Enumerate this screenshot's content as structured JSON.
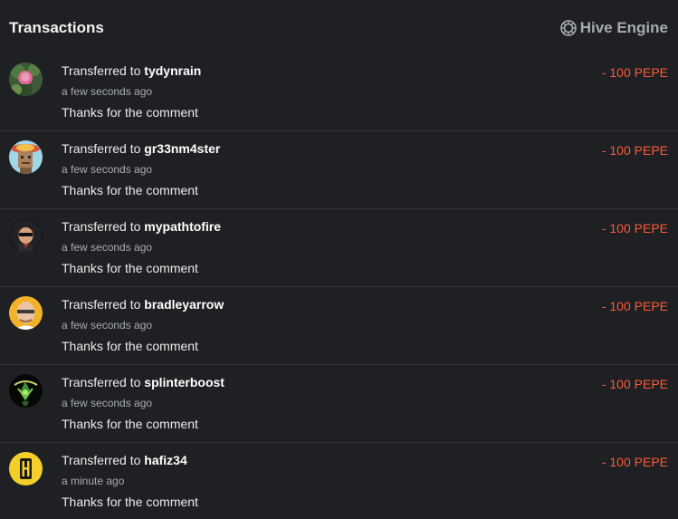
{
  "header": {
    "title": "Transactions",
    "engine_label": "Hive Engine",
    "engine_icon": "hive-engine-icon"
  },
  "colors": {
    "background": "#1e2023",
    "amount": "#ff5a36",
    "divider": "#33363a"
  },
  "transactions": [
    {
      "prefix": "Transferred to",
      "user": "tydynrain",
      "time": "a few seconds ago",
      "memo": "Thanks for the comment",
      "amount": "- 100 PEPE",
      "avatar": "avatar-tydynrain"
    },
    {
      "prefix": "Transferred to",
      "user": "gr33nm4ster",
      "time": "a few seconds ago",
      "memo": "Thanks for the comment",
      "amount": "- 100 PEPE",
      "avatar": "avatar-gr33nm4ster"
    },
    {
      "prefix": "Transferred to",
      "user": "mypathtofire",
      "time": "a few seconds ago",
      "memo": "Thanks for the comment",
      "amount": "- 100 PEPE",
      "avatar": "avatar-mypathtofire"
    },
    {
      "prefix": "Transferred to",
      "user": "bradleyarrow",
      "time": "a few seconds ago",
      "memo": "Thanks for the comment",
      "amount": "- 100 PEPE",
      "avatar": "avatar-bradleyarrow"
    },
    {
      "prefix": "Transferred to",
      "user": "splinterboost",
      "time": "a few seconds ago",
      "memo": "Thanks for the comment",
      "amount": "- 100 PEPE",
      "avatar": "avatar-splinterboost"
    },
    {
      "prefix": "Transferred to",
      "user": "hafiz34",
      "time": "a minute ago",
      "memo": "Thanks for the comment",
      "amount": "- 100 PEPE",
      "avatar": "avatar-hafiz34"
    }
  ]
}
